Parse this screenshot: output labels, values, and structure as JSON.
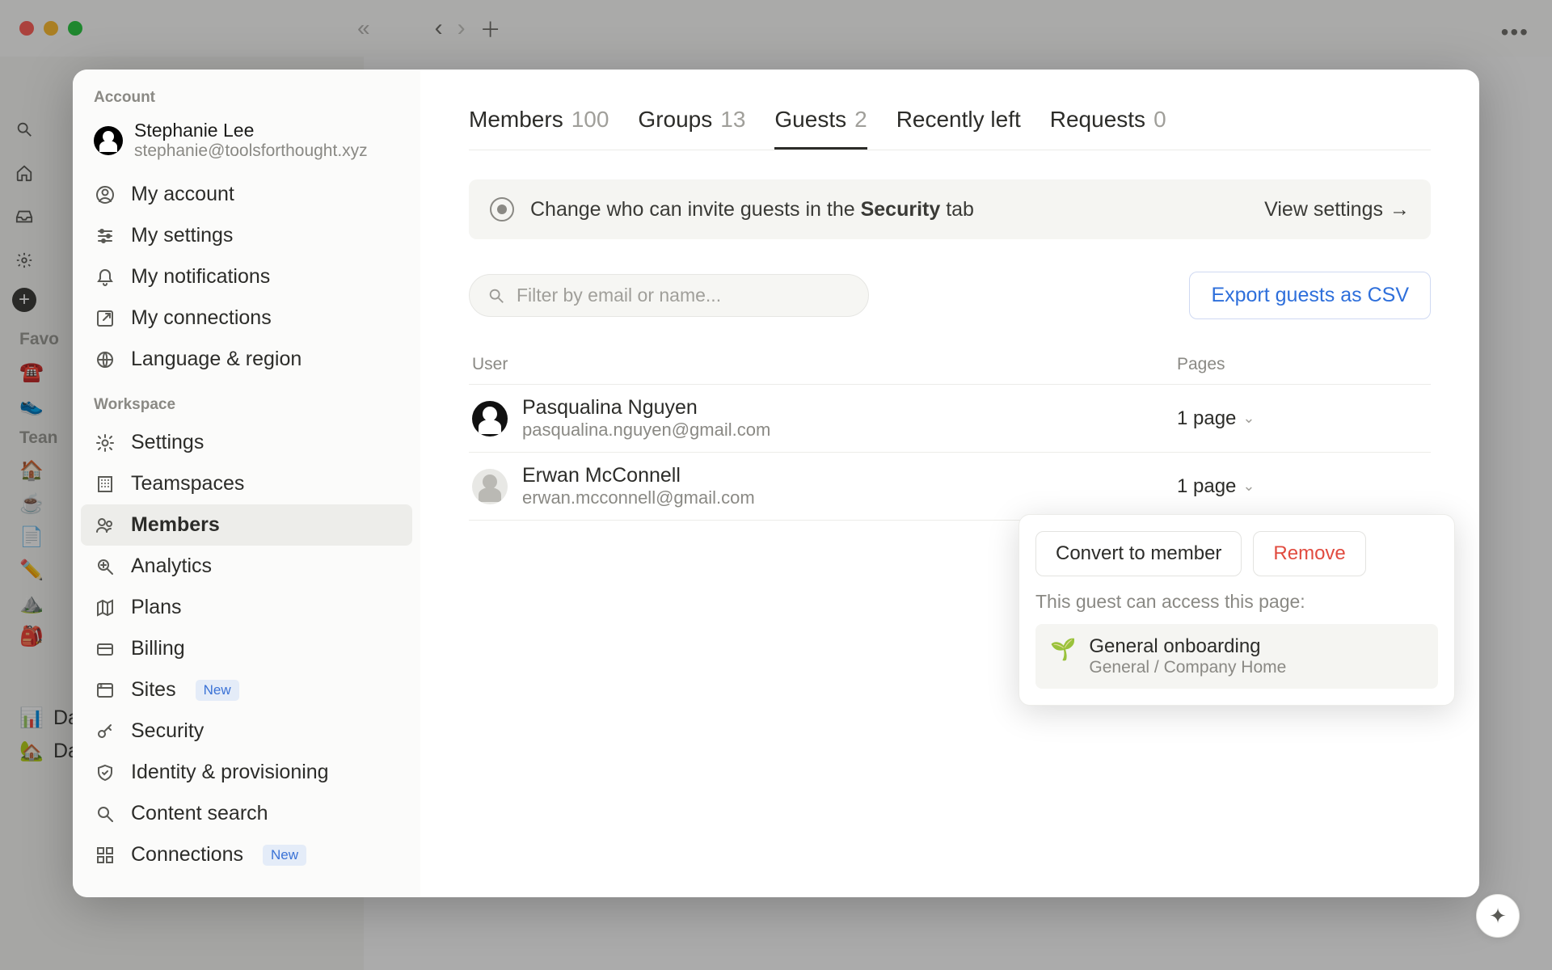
{
  "chrome": {
    "traffic": [
      "close",
      "minimize",
      "zoom"
    ]
  },
  "bg_rail": {
    "groups": [
      {
        "label": "Favo"
      },
      {
        "label": "Tean"
      }
    ],
    "items_bottom": [
      {
        "emoji": "📊",
        "label": "Data"
      },
      {
        "emoji": "🏠",
        "label": "Data Home"
      }
    ]
  },
  "sidebar": {
    "section_account": "Account",
    "profile": {
      "name": "Stephanie Lee",
      "email": "stephanie@toolsforthought.xyz"
    },
    "account_items": [
      {
        "icon": "user-circle",
        "label": "My account"
      },
      {
        "icon": "sliders",
        "label": "My settings"
      },
      {
        "icon": "bell",
        "label": "My notifications"
      },
      {
        "icon": "arrow-out",
        "label": "My connections"
      },
      {
        "icon": "globe",
        "label": "Language & region"
      }
    ],
    "section_workspace": "Workspace",
    "workspace_items": [
      {
        "icon": "gear",
        "label": "Settings"
      },
      {
        "icon": "building",
        "label": "Teamspaces"
      },
      {
        "icon": "users",
        "label": "Members",
        "active": true
      },
      {
        "icon": "search-plus",
        "label": "Analytics"
      },
      {
        "icon": "map",
        "label": "Plans"
      },
      {
        "icon": "card",
        "label": "Billing"
      },
      {
        "icon": "browser",
        "label": "Sites",
        "badge": "New"
      },
      {
        "icon": "key",
        "label": "Security"
      },
      {
        "icon": "shield",
        "label": "Identity & provisioning"
      },
      {
        "icon": "search",
        "label": "Content search"
      },
      {
        "icon": "grid",
        "label": "Connections",
        "badge": "New"
      }
    ]
  },
  "main": {
    "tabs": [
      {
        "label": "Members",
        "count": "100"
      },
      {
        "label": "Groups",
        "count": "13"
      },
      {
        "label": "Guests",
        "count": "2",
        "active": true
      },
      {
        "label": "Recently left",
        "count": ""
      },
      {
        "label": "Requests",
        "count": "0"
      }
    ],
    "notice": {
      "text_pre": "Change who can invite guests in the ",
      "text_bold": "Security",
      "text_post": " tab",
      "link": "View settings"
    },
    "search_placeholder": "Filter by email or name...",
    "export_label": "Export guests as CSV",
    "columns": {
      "user": "User",
      "pages": "Pages"
    },
    "guests": [
      {
        "name": "Pasqualina Nguyen",
        "email": "pasqualina.nguyen@gmail.com",
        "pages": "1 page",
        "avatar": "dark"
      },
      {
        "name": "Erwan McConnell",
        "email": "erwan.mcconnell@gmail.com",
        "pages": "1 page",
        "avatar": "light"
      }
    ],
    "popover": {
      "convert": "Convert to member",
      "remove": "Remove",
      "desc": "This guest can access this page:",
      "page": {
        "icon": "🌱",
        "title": "General onboarding",
        "path": "General / Company Home"
      }
    }
  }
}
